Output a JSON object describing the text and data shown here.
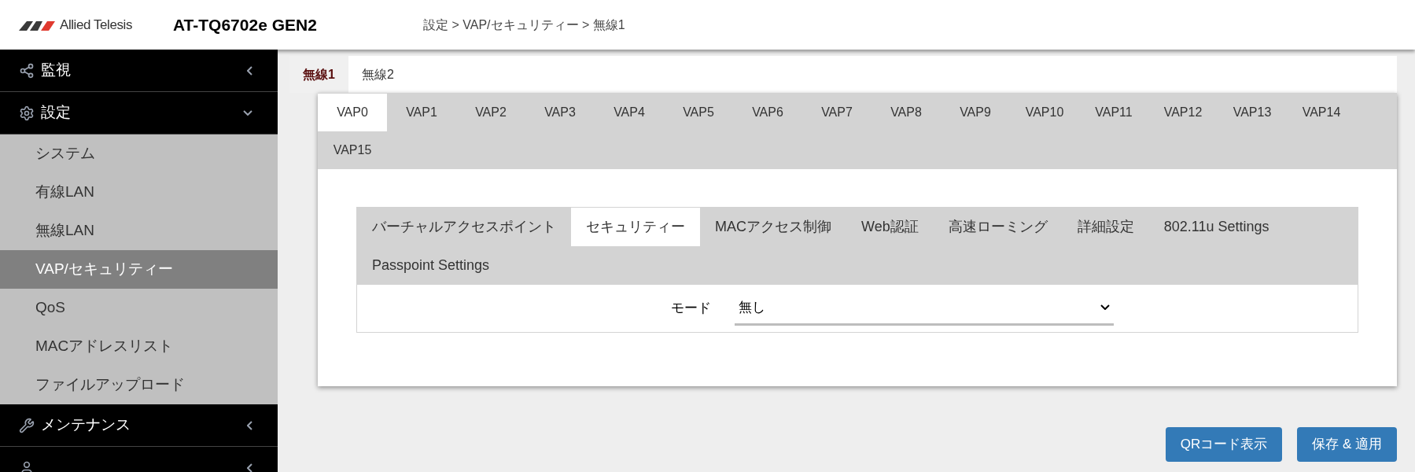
{
  "header": {
    "logo_text": "Allied Telesis",
    "product": "AT-TQ6702e GEN2",
    "breadcrumb": "設定 > VAP/セキュリティー > 無線1"
  },
  "sidebar": {
    "sections": [
      {
        "label": "監視",
        "kind": "share",
        "expanded": false
      },
      {
        "label": "設定",
        "kind": "gear",
        "expanded": true,
        "items": [
          {
            "label": "システム",
            "selected": false
          },
          {
            "label": "有線LAN",
            "selected": false
          },
          {
            "label": "無線LAN",
            "selected": false
          },
          {
            "label": "VAP/セキュリティー",
            "selected": true
          },
          {
            "label": "QoS",
            "selected": false
          },
          {
            "label": "MACアドレスリスト",
            "selected": false
          },
          {
            "label": "ファイルアップロード",
            "selected": false
          }
        ]
      },
      {
        "label": "メンテナンス",
        "kind": "wrench",
        "expanded": false
      },
      {
        "kind": "user",
        "expanded": false
      }
    ]
  },
  "radio_tabs": [
    {
      "label": "無線1",
      "selected": true
    },
    {
      "label": "無線2",
      "selected": false
    }
  ],
  "vap_tabs": [
    {
      "label": "VAP0",
      "selected": true
    },
    {
      "label": "VAP1",
      "selected": false
    },
    {
      "label": "VAP2",
      "selected": false
    },
    {
      "label": "VAP3",
      "selected": false
    },
    {
      "label": "VAP4",
      "selected": false
    },
    {
      "label": "VAP5",
      "selected": false
    },
    {
      "label": "VAP6",
      "selected": false
    },
    {
      "label": "VAP7",
      "selected": false
    },
    {
      "label": "VAP8",
      "selected": false
    },
    {
      "label": "VAP9",
      "selected": false
    },
    {
      "label": "VAP10",
      "selected": false
    },
    {
      "label": "VAP11",
      "selected": false
    },
    {
      "label": "VAP12",
      "selected": false
    },
    {
      "label": "VAP13",
      "selected": false
    },
    {
      "label": "VAP14",
      "selected": false
    },
    {
      "label": "VAP15",
      "selected": false
    }
  ],
  "section_tabs": [
    {
      "label": "バーチャルアクセスポイント",
      "selected": false
    },
    {
      "label": "セキュリティー",
      "selected": true
    },
    {
      "label": "MACアクセス制御",
      "selected": false
    },
    {
      "label": "Web認証",
      "selected": false
    },
    {
      "label": "高速ローミング",
      "selected": false
    },
    {
      "label": "詳細設定",
      "selected": false
    },
    {
      "label": "802.11u Settings",
      "selected": false
    },
    {
      "label": "Passpoint Settings",
      "selected": false
    }
  ],
  "form": {
    "mode_label": "モード",
    "mode_value": "無し"
  },
  "buttons": [
    "QRコード表示",
    "保存 & 適用"
  ]
}
